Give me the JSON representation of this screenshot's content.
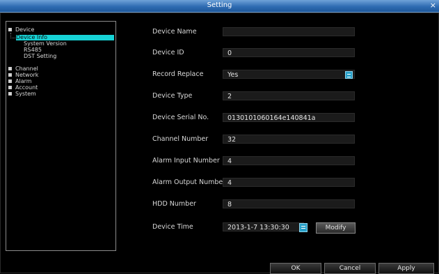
{
  "window": {
    "title": "Setting",
    "close_glyph": "×"
  },
  "tree": {
    "root": "Device",
    "children": [
      "Device Info",
      "System Version",
      "RS485",
      "DST Setting"
    ],
    "items": [
      "Channel",
      "Network",
      "Alarm",
      "Account",
      "System"
    ]
  },
  "form": {
    "device_name": {
      "label": "Device Name",
      "value": ""
    },
    "device_id": {
      "label": "Device ID",
      "value": "0"
    },
    "record_replace": {
      "label": "Record Replace",
      "value": "Yes"
    },
    "device_type": {
      "label": "Device Type",
      "value": "2"
    },
    "serial_no": {
      "label": "Device Serial No.",
      "value": "0130101060164e140841a"
    },
    "channel_number": {
      "label": "Channel Number",
      "value": "32"
    },
    "alarm_input": {
      "label": "Alarm Input Number",
      "value": "4"
    },
    "alarm_output": {
      "label": "Alarm Output Number",
      "value": "4"
    },
    "hdd_number": {
      "label": "HDD Number",
      "value": "8"
    },
    "device_time": {
      "label": "Device Time",
      "value": "2013-1-7 13:30:30",
      "modify_label": "Modify"
    }
  },
  "footer": {
    "ok": "OK",
    "cancel": "Cancel",
    "apply": "Apply"
  },
  "colors": {
    "titlebar": "#2f6cb3",
    "selected": "#17d3d6",
    "accent_button": "#28a1c9"
  },
  "icons": {
    "close": "close-icon",
    "dropdown": "dropdown-arrow-icon",
    "spinner": "time-spinner-icon",
    "tree_node": "tree-node-icon"
  }
}
